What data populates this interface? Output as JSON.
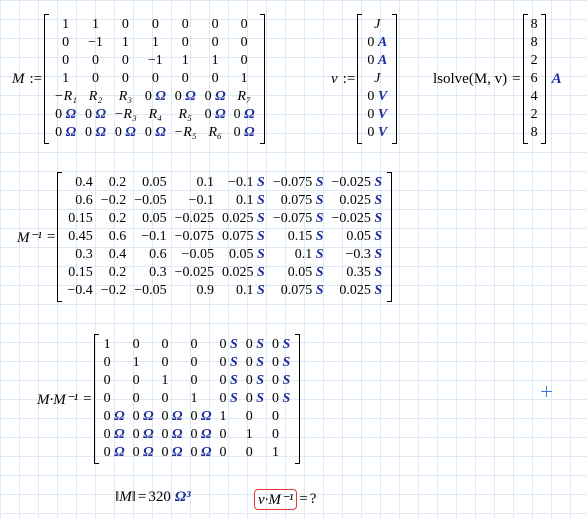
{
  "matrix_M": {
    "label": "M",
    "assign": ":=",
    "rows": [
      [
        "1",
        "1",
        "0",
        "0",
        "0",
        "0",
        "0"
      ],
      [
        "0",
        "−1",
        "1",
        "1",
        "0",
        "0",
        "0"
      ],
      [
        "0",
        "0",
        "0",
        "−1",
        "1",
        "1",
        "0"
      ],
      [
        "1",
        "0",
        "0",
        "0",
        "0",
        "0",
        "1"
      ],
      [
        "−R₁",
        "R₂",
        "R₃",
        "0 Ω",
        "0 Ω",
        "0 Ω",
        "R₇"
      ],
      [
        "0 Ω",
        "0 Ω",
        "−R₃",
        "R₄",
        "R₅",
        "0 Ω",
        "0 Ω"
      ],
      [
        "0 Ω",
        "0 Ω",
        "0 Ω",
        "0 Ω",
        "−R₅",
        "R₆",
        "0 Ω"
      ]
    ]
  },
  "vector_v": {
    "label": "v",
    "assign": ":=",
    "rows": [
      "J",
      "0 A",
      "0 A",
      "J",
      "0 V",
      "0 V",
      "0 V"
    ]
  },
  "lsolve": {
    "expr": "lsolve(M, v)",
    "eq": "=",
    "values": [
      "8",
      "8",
      "2",
      "6",
      "4",
      "2",
      "8"
    ],
    "unit": "A"
  },
  "matrix_Minv": {
    "label": "M⁻¹",
    "eq": "=",
    "rows": [
      [
        "0.4",
        "0.2",
        "0.05",
        "0.1",
        "−0.1 S",
        "−0.075 S",
        "−0.025 S"
      ],
      [
        "0.6",
        "−0.2",
        "−0.05",
        "−0.1",
        "0.1 S",
        "0.075 S",
        "0.025 S"
      ],
      [
        "0.15",
        "0.2",
        "0.05",
        "−0.025",
        "0.025 S",
        "−0.075 S",
        "−0.025 S"
      ],
      [
        "0.45",
        "0.6",
        "−0.1",
        "−0.075",
        "0.075 S",
        "0.15 S",
        "0.05 S"
      ],
      [
        "0.3",
        "0.4",
        "0.6",
        "−0.05",
        "0.05 S",
        "0.1 S",
        "−0.3 S"
      ],
      [
        "0.15",
        "0.2",
        "0.3",
        "−0.025",
        "0.025 S",
        "0.05 S",
        "0.35 S"
      ],
      [
        "−0.4",
        "−0.2",
        "−0.05",
        "0.9",
        "0.1 S",
        "0.075 S",
        "0.025 S"
      ]
    ]
  },
  "product": {
    "label": "M·M⁻¹",
    "eq": "=",
    "rows": [
      [
        "1",
        "0",
        "0",
        "0",
        "0 S",
        "0 S",
        "0 S"
      ],
      [
        "0",
        "1",
        "0",
        "0",
        "0 S",
        "0 S",
        "0 S"
      ],
      [
        "0",
        "0",
        "1",
        "0",
        "0 S",
        "0 S",
        "0 S"
      ],
      [
        "0",
        "0",
        "0",
        "1",
        "0 S",
        "0 S",
        "0 S"
      ],
      [
        "0 Ω",
        "0 Ω",
        "0 Ω",
        "0 Ω",
        "1",
        "0",
        "0"
      ],
      [
        "0 Ω",
        "0 Ω",
        "0 Ω",
        "0 Ω",
        "0",
        "1",
        "0"
      ],
      [
        "0 Ω",
        "0 Ω",
        "0 Ω",
        "0 Ω",
        "0",
        "0",
        "1"
      ]
    ]
  },
  "determinant": {
    "expr": "‖M‖",
    "eq": "=",
    "value": "320",
    "unit": "Ω³"
  },
  "error_expr": {
    "expr": "v·M⁻¹",
    "eq": "=",
    "result": "?",
    "highlight_color": "#e0393a"
  },
  "colors": {
    "unit": "#1d2c9c",
    "grid": "#dde9f4"
  }
}
